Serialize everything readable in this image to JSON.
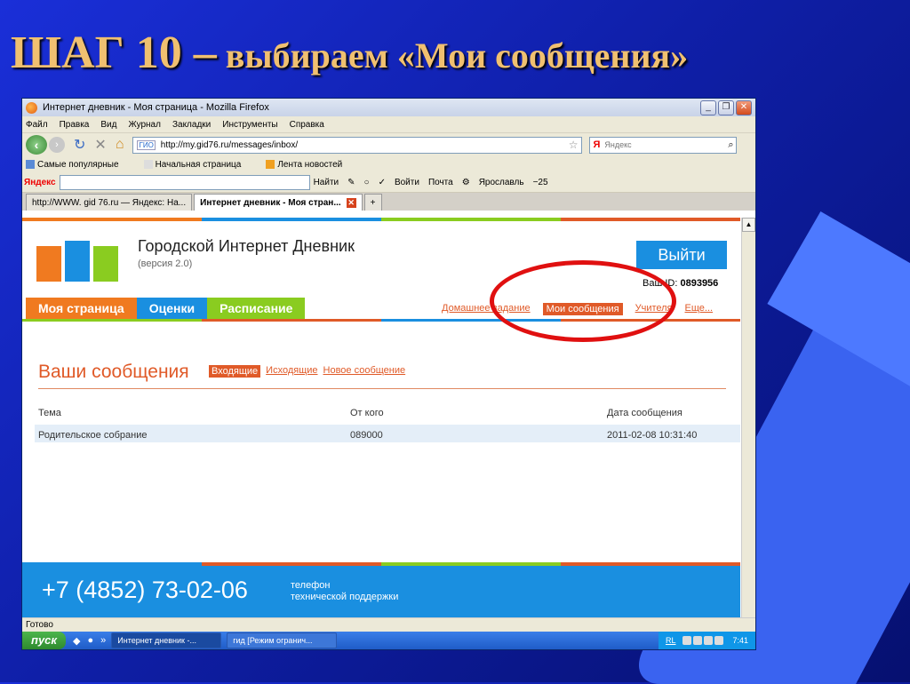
{
  "slide": {
    "title_big": "ШАГ 10 –",
    "title_small": " выбираем «Мои сообщения»"
  },
  "browser": {
    "title": "Интернет дневник - Моя страница - Mozilla Firefox",
    "menu": [
      "Файл",
      "Правка",
      "Вид",
      "Журнал",
      "Закладки",
      "Инструменты",
      "Справка"
    ],
    "url": "http://my.gid76.ru/messages/inbox/",
    "url_badge": "ГИО",
    "search_placeholder": "Яндекс",
    "search_logo": "Я",
    "bookmarks": [
      "Самые популярные",
      "Начальная страница",
      "Лента новостей"
    ],
    "yandex_bar": {
      "logo": "Яндекс",
      "items": [
        "Найти",
        "Войти",
        "Почта",
        "Ярославль",
        "−25"
      ]
    },
    "tabs": [
      {
        "label": "http://WWW. gid 76.ru — Яндекс: На..."
      },
      {
        "label": "Интернет дневник - Моя стран..."
      }
    ],
    "status": "Готово"
  },
  "site": {
    "title": "Городской Интернет Дневник",
    "version": "(версия 2.0)",
    "logout": "Выйти",
    "user_prefix": "Ваш ID:",
    "user_id": "0893956",
    "main_tabs": [
      {
        "label": "Моя страница",
        "color": "#f07a20"
      },
      {
        "label": "Оценки",
        "color": "#1a8fe0"
      },
      {
        "label": "Расписание",
        "color": "#8acc20"
      }
    ],
    "subnav": [
      "Домашнее задание",
      "Мои сообщения",
      "Учителя",
      "Еще..."
    ],
    "messages": {
      "heading": "Ваши сообщения",
      "tabs": [
        "Входящие",
        "Исходящие",
        "Новое сообщение"
      ],
      "columns": [
        "Тема",
        "От кого",
        "Дата сообщения"
      ],
      "rows": [
        {
          "subject": "Родительское собрание",
          "from": "089000",
          "date": "2011-02-08 10:31:40"
        }
      ]
    },
    "footer": {
      "phone": "+7 (4852) 73-02-06",
      "support_line1": "телефон",
      "support_line2": "технической поддержки"
    }
  },
  "taskbar": {
    "start": "пуск",
    "buttons": [
      "Интернет дневник -...",
      "гид [Режим огранич..."
    ],
    "lang": "RL",
    "time": "7:41"
  }
}
